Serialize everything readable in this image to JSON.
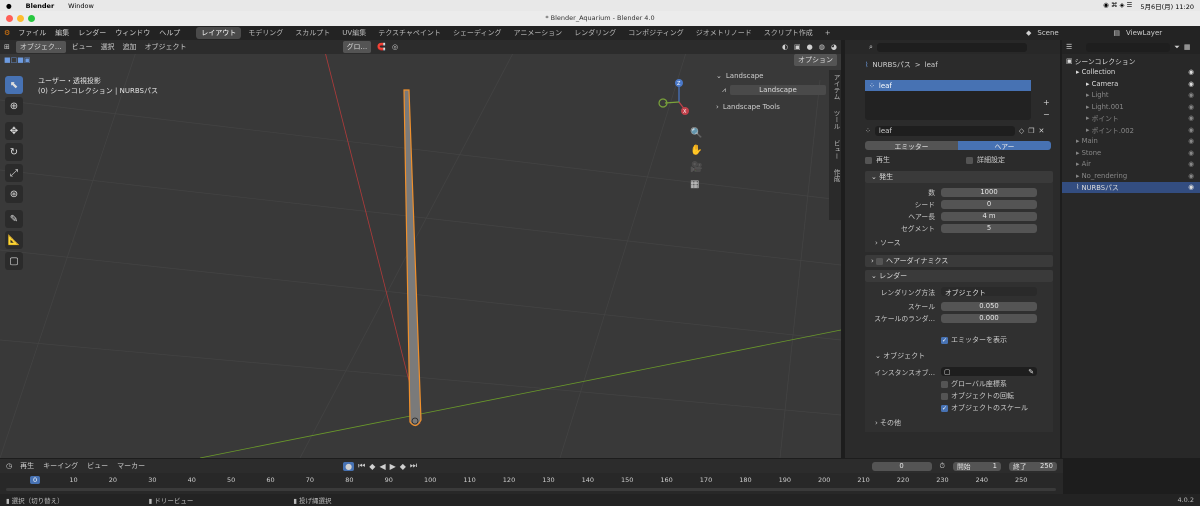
{
  "mac_menu": {
    "apple": "",
    "app": "Blender",
    "window": "Window",
    "clock": "5月6日(月) 11:20"
  },
  "window_title": "* Blender_Aquarium - Blender 4.0",
  "top_menu": [
    "ファイル",
    "編集",
    "レンダー",
    "ウィンドウ",
    "ヘルプ"
  ],
  "workspaces": [
    "レイアウト",
    "モデリング",
    "スカルプト",
    "UV編集",
    "テクスチャペイント",
    "シェーディング",
    "アニメーション",
    "レンダリング",
    "コンポジティング",
    "ジオメトリノード",
    "スクリプト作成",
    "+"
  ],
  "scene": "Scene",
  "view_layer": "ViewLayer",
  "viewport": {
    "mode": "オブジェク...",
    "menus": [
      "ビュー",
      "選択",
      "追加",
      "オブジェクト"
    ],
    "orientation": "グロ...",
    "options": "オプション",
    "info_line1": "ユーザー・透視投影",
    "info_line2": "(0) シーンコレクション | NURBSパス",
    "gizmo": {
      "z": "Z",
      "x": "X",
      "y": "Y"
    }
  },
  "npanel": {
    "header": "Landscape",
    "button": "Landscape",
    "tools": "Landscape Tools",
    "tabs": [
      "アイテム",
      "ツール",
      "ビュー",
      "作成"
    ]
  },
  "props": {
    "breadcrumb_obj": "NURBSパス",
    "breadcrumb_sep": ">",
    "breadcrumb_psys": "leaf",
    "list_item": "leaf",
    "psys_name": "leaf",
    "tab_emitter": "エミッター",
    "tab_hair": "ヘアー",
    "regrow": "再生",
    "advanced": "詳細設定",
    "emission": {
      "title": "発生",
      "number_label": "数",
      "number": "1000",
      "seed_label": "シード",
      "seed": "0",
      "hair_length_label": "ヘアー長",
      "hair_length": "4 m",
      "segments_label": "セグメント",
      "segments": "5"
    },
    "source": "ソース",
    "hair_dynamics": "ヘアーダイナミクス",
    "render": {
      "title": "レンダー",
      "render_as_label": "レンダリング方法",
      "render_as": "オブジェクト",
      "scale_label": "スケール",
      "scale": "0.050",
      "scale_rand_label": "スケールのランダ...",
      "scale_rand": "0.000",
      "show_emitter": "エミッターを表示"
    },
    "object": {
      "title": "オブジェクト",
      "instance_label": "インスタンスオブ...",
      "global_coords": "グローバル座標系",
      "object_rotation": "オブジェクトの回転",
      "object_scale": "オブジェクトのスケール"
    },
    "other": "その他"
  },
  "outliner": {
    "title": "シーンコレクション",
    "items": [
      {
        "name": "Collection",
        "dim": false,
        "sel": false,
        "indent": 1
      },
      {
        "name": "Camera",
        "dim": false,
        "sel": false,
        "indent": 2
      },
      {
        "name": "Light",
        "dim": true,
        "sel": false,
        "indent": 2
      },
      {
        "name": "Light.001",
        "dim": true,
        "sel": false,
        "indent": 2
      },
      {
        "name": "ポイント",
        "dim": true,
        "sel": false,
        "indent": 2
      },
      {
        "name": "ポイント.002",
        "dim": true,
        "sel": false,
        "indent": 2
      },
      {
        "name": "Main",
        "dim": true,
        "sel": false,
        "indent": 1
      },
      {
        "name": "Stone",
        "dim": true,
        "sel": false,
        "indent": 1
      },
      {
        "name": "Air",
        "dim": true,
        "sel": false,
        "indent": 1
      },
      {
        "name": "No_rendering",
        "dim": true,
        "sel": false,
        "indent": 1
      },
      {
        "name": "NURBSパス",
        "dim": false,
        "sel": true,
        "indent": 1
      }
    ]
  },
  "timeline": {
    "menus": [
      "再生",
      "キーイング",
      "ビュー",
      "マーカー"
    ],
    "current_frame": "0",
    "start_label": "開始",
    "start": "1",
    "end_label": "終了",
    "end": "250",
    "ticks": [
      "0",
      "10",
      "20",
      "30",
      "40",
      "50",
      "60",
      "70",
      "80",
      "90",
      "100",
      "110",
      "120",
      "130",
      "140",
      "150",
      "160",
      "170",
      "180",
      "190",
      "200",
      "210",
      "220",
      "230",
      "240",
      "250"
    ]
  },
  "status": {
    "select": "選択（切り替え）",
    "dolly": "ドリービュー",
    "lasso": "投げ縄選択",
    "version": "4.0.2"
  },
  "colors": {
    "accent": "#4772b3",
    "orange": "#f0902c",
    "xaxis": "#b03a3a",
    "yaxis": "#6a9a2a"
  }
}
